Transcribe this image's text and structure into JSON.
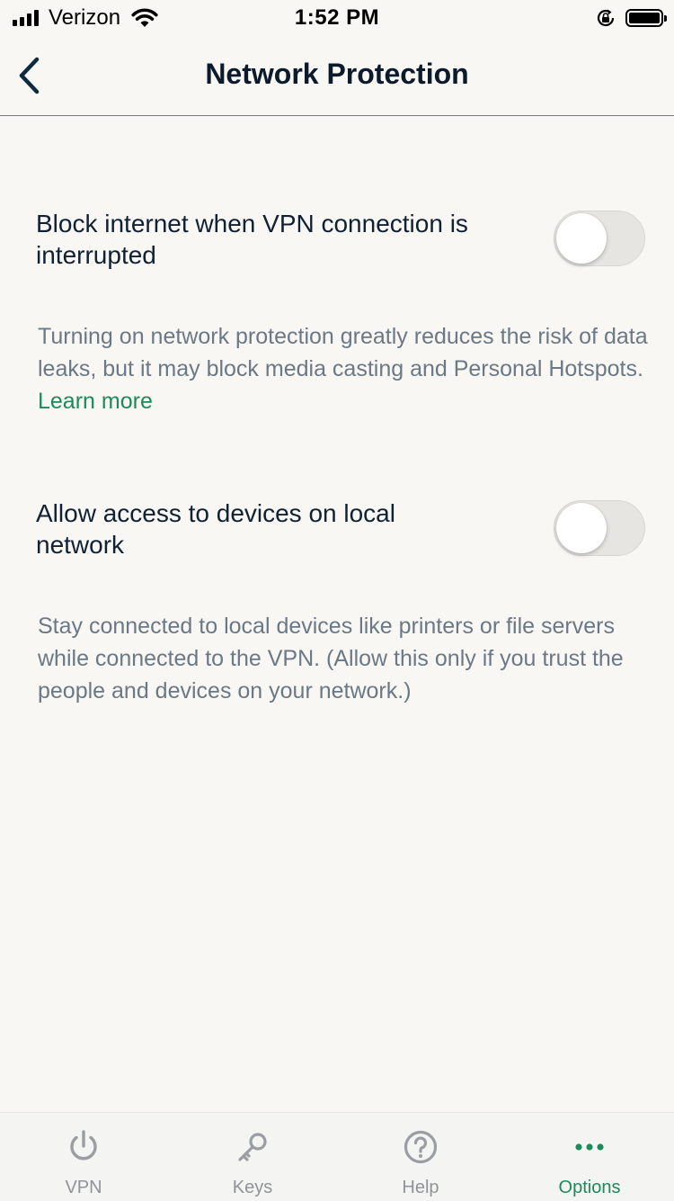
{
  "status_bar": {
    "carrier": "Verizon",
    "time": "1:52 PM"
  },
  "nav": {
    "title": "Network Protection"
  },
  "settings": [
    {
      "label": "Block internet when VPN connection is interrupted",
      "enabled": false,
      "description": "Turning on network protection greatly reduces the risk of data leaks, but it may block media casting and Personal Hotspots.",
      "link": "Learn more"
    },
    {
      "label": "Allow access to devices on local network",
      "enabled": false,
      "description": "Stay connected to local devices like printers or file servers while connected to the VPN. (Allow this only if you trust the people and devices on your network.)"
    }
  ],
  "tabs": [
    {
      "label": "VPN",
      "icon": "power-icon",
      "active": false
    },
    {
      "label": "Keys",
      "icon": "key-icon",
      "active": false
    },
    {
      "label": "Help",
      "icon": "help-icon",
      "active": false
    },
    {
      "label": "Options",
      "icon": "more-icon",
      "active": true
    }
  ],
  "colors": {
    "background": "#f8f7f3",
    "accent": "#1d8a5a",
    "muted_text": "#6b7885",
    "toggle_off": "#e6e5e1"
  }
}
